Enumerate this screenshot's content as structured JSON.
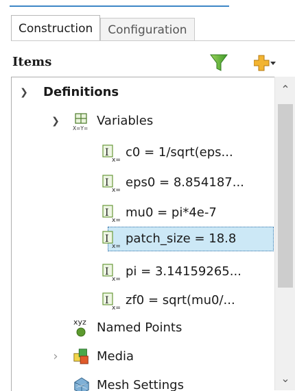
{
  "tabs": [
    {
      "label": "Construction",
      "active": true
    },
    {
      "label": "Configuration",
      "active": false
    }
  ],
  "items_panel": {
    "title": "Items",
    "filter_icon": "filter-funnel-icon",
    "add_icon": "add-plus-icon"
  },
  "tree": {
    "definitions": {
      "label": "Definitions",
      "expanded": true
    },
    "variables": {
      "label": "Variables",
      "expanded": true,
      "icon": "variables-icon"
    },
    "variable_items": [
      {
        "label": "c0 = 1/sqrt(eps...",
        "selected": false
      },
      {
        "label": "eps0 = 8.854187...",
        "selected": false
      },
      {
        "label": "mu0 = pi*4e-7",
        "selected": false
      },
      {
        "label": "patch_size = 18.8",
        "selected": true
      },
      {
        "label": "pi = 3.14159265...",
        "selected": false
      },
      {
        "label": "zf0 = sqrt(mu0/...",
        "selected": false
      }
    ],
    "named_points": {
      "label": "Named Points",
      "icon_text": "xyz"
    },
    "media": {
      "label": "Media",
      "expanded": false
    },
    "mesh_settings": {
      "label": "Mesh Settings"
    }
  },
  "colors": {
    "selection_bg": "#cce8f6",
    "accent_blue": "#3c86c6",
    "variable_icon_green": "#6a9a3a"
  }
}
